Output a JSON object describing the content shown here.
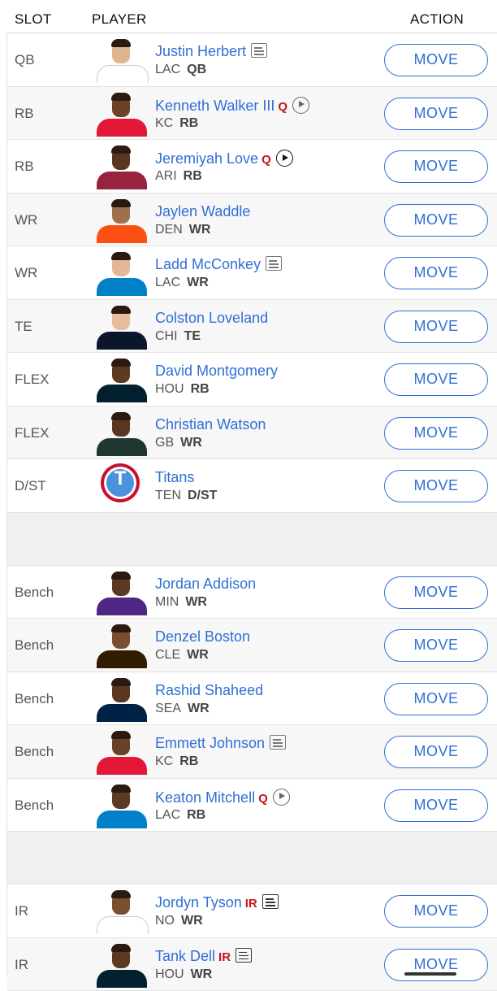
{
  "header": {
    "slot": "SLOT",
    "player": "PLAYER",
    "action": "ACTION"
  },
  "move_label": "MOVE",
  "starters": [
    {
      "slot": "QB",
      "name": "Justin Herbert",
      "status": "",
      "icon": "news-icon",
      "team": "LAC",
      "pos": "QB",
      "jersey": "#ffffff",
      "skin": "#e0b48f"
    },
    {
      "slot": "RB",
      "name": "Kenneth Walker III",
      "status": "Q",
      "icon": "play-icon",
      "team": "KC",
      "pos": "RB",
      "jersey": "#e31837",
      "skin": "#6b4226"
    },
    {
      "slot": "RB",
      "name": "Jeremiyah Love",
      "status": "Q",
      "icon": "play-icon-dark",
      "team": "ARI",
      "pos": "RB",
      "jersey": "#97233f",
      "skin": "#5a3520"
    },
    {
      "slot": "WR",
      "name": "Jaylen Waddle",
      "status": "",
      "icon": "",
      "team": "DEN",
      "pos": "WR",
      "jersey": "#fb4f14",
      "skin": "#a0704c"
    },
    {
      "slot": "WR",
      "name": "Ladd McConkey",
      "status": "",
      "icon": "news-icon",
      "team": "LAC",
      "pos": "WR",
      "jersey": "#0080c6",
      "skin": "#e3b896"
    },
    {
      "slot": "TE",
      "name": "Colston Loveland",
      "status": "",
      "icon": "",
      "team": "CHI",
      "pos": "TE",
      "jersey": "#0b162a",
      "skin": "#e6bd9a"
    },
    {
      "slot": "FLEX",
      "name": "David Montgomery",
      "status": "",
      "icon": "",
      "team": "HOU",
      "pos": "RB",
      "jersey": "#03202f",
      "skin": "#5e3a22"
    },
    {
      "slot": "FLEX",
      "name": "Christian Watson",
      "status": "",
      "icon": "",
      "team": "GB",
      "pos": "WR",
      "jersey": "#203731",
      "skin": "#5a3620"
    },
    {
      "slot": "D/ST",
      "name": "Titans",
      "status": "",
      "icon": "",
      "team": "TEN",
      "pos": "D/ST",
      "logo": "T"
    }
  ],
  "bench": [
    {
      "slot": "Bench",
      "name": "Jordan Addison",
      "status": "",
      "icon": "",
      "team": "MIN",
      "pos": "WR",
      "jersey": "#4f2683",
      "skin": "#5b3a24"
    },
    {
      "slot": "Bench",
      "name": "Denzel Boston",
      "status": "",
      "icon": "",
      "team": "CLE",
      "pos": "WR",
      "jersey": "#311d00",
      "skin": "#7a4d2e"
    },
    {
      "slot": "Bench",
      "name": "Rashid Shaheed",
      "status": "",
      "icon": "",
      "team": "SEA",
      "pos": "WR",
      "jersey": "#002244",
      "skin": "#5a3820"
    },
    {
      "slot": "Bench",
      "name": "Emmett Johnson",
      "status": "",
      "icon": "news-icon",
      "team": "KC",
      "pos": "RB",
      "jersey": "#e31837",
      "skin": "#6a4127"
    },
    {
      "slot": "Bench",
      "name": "Keaton Mitchell",
      "status": "Q",
      "icon": "play-icon",
      "team": "LAC",
      "pos": "RB",
      "jersey": "#0080c6",
      "skin": "#5d3a23"
    }
  ],
  "ir": [
    {
      "slot": "IR",
      "name": "Jordyn Tyson",
      "status": "IR",
      "icon": "news-icon-dark",
      "team": "NO",
      "pos": "WR",
      "jersey": "#ffffff",
      "skin": "#7b4e2f"
    },
    {
      "slot": "IR",
      "name": "Tank Dell",
      "status": "IR",
      "icon": "news-icon-dark",
      "team": "HOU",
      "pos": "WR",
      "jersey": "#03202f",
      "skin": "#5c3920"
    }
  ]
}
